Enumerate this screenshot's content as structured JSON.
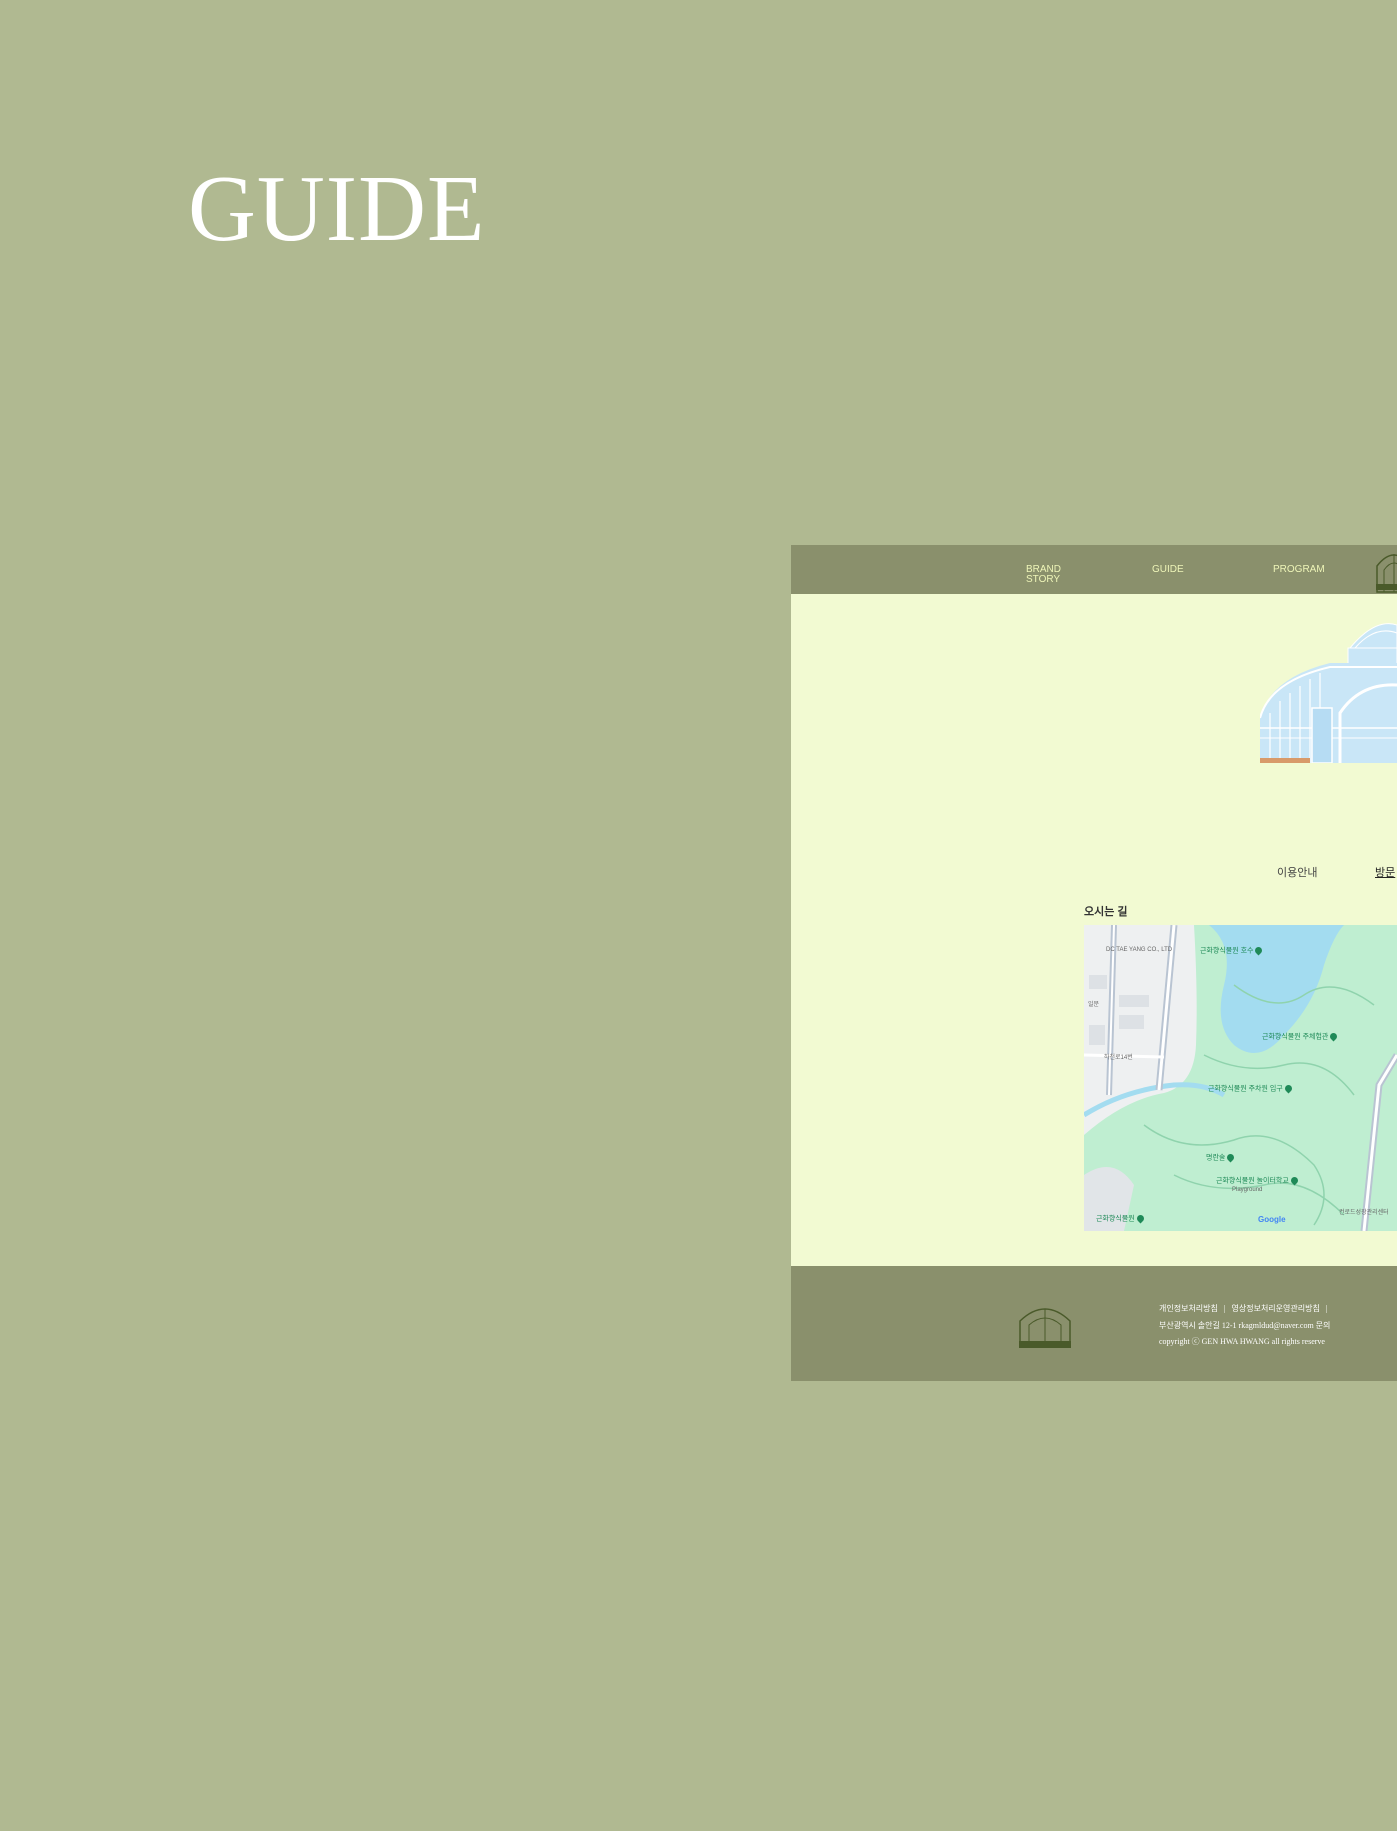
{
  "page_title": "GUIDE",
  "nav": {
    "items": [
      "BRAND\nSTORY",
      "GUIDE",
      "PROGRAM"
    ],
    "logo": "greenhouse-logo-icon"
  },
  "tabs": {
    "items": [
      "이용안내",
      "방문"
    ],
    "active_index": 1
  },
  "directions": {
    "title": "오시는 길",
    "map": {
      "pois": [
        "근화향식물원 호수",
        "근화향식물원 주체험관",
        "근화향식물원 주차원 입구",
        "명란술",
        "근화향식물원 놀이터학교",
        "근화향식물원"
      ],
      "labels": [
        "DC TAE YANG CO., LTD",
        "일문",
        "하천로14번",
        "Playground",
        "컨로드성장관리센터"
      ],
      "attribution": "Google"
    }
  },
  "footer": {
    "links": [
      "개인정보처리방침",
      "영상정보처리운영관리방침"
    ],
    "address": "부산광역시 솔안길 12-1 rkagmldud@naver.com 문의",
    "copyright": "copyright ⓒ GEN HWA HWANG all rights reserve",
    "logo_text": "GEN HWA HWANG",
    "colors": {
      "nav_bg": "#8a906c",
      "page_bg": "#b0b991",
      "content_bg": "#f2fad2",
      "nav_text": "#eef5b8"
    }
  }
}
